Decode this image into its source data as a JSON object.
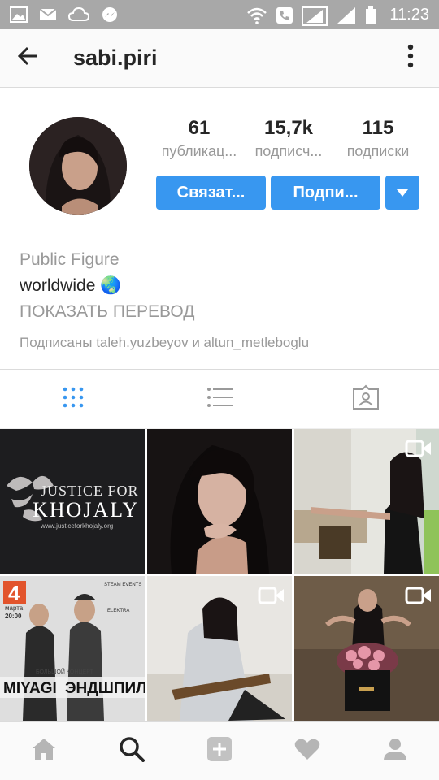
{
  "status_bar": {
    "time": "11:23"
  },
  "top_bar": {
    "username": "sabi.piri"
  },
  "profile": {
    "stats": [
      {
        "value": "61",
        "label": "публикац..."
      },
      {
        "value": "15,7k",
        "label": "подписч..."
      },
      {
        "value": "115",
        "label": "подписки"
      }
    ],
    "buttons": {
      "contact": "Связат...",
      "follow": "Подпи..."
    },
    "bio": {
      "category": "Public Figure",
      "text": "worldwide 🌏",
      "translate": "ПОКАЗАТЬ ПЕРЕВОД",
      "followed_by": "Подписаны taleh.yuzbeyov и altun_metleboglu"
    }
  },
  "grid": {
    "post1_line1": "JUSTICE FOR",
    "post1_line2": "KHOJALY",
    "post1_url": "www.justiceforkhojaly.org",
    "post4_date": "4",
    "post4_month": "марта",
    "post4_time": "20:00",
    "post4_artist": "MIYAGI",
    "post4_artist2": "ЭНДШПИЛЬ",
    "post4_tag": "БОЛЬШОЙ КОНЦЕРТ",
    "post4_sponsor": "STEAM EVENTS",
    "post4_venue": "ELEKTRA"
  },
  "colors": {
    "accent": "#3897f0",
    "status_bar": "#a8a8a8",
    "active_tab": "#3897f0"
  }
}
